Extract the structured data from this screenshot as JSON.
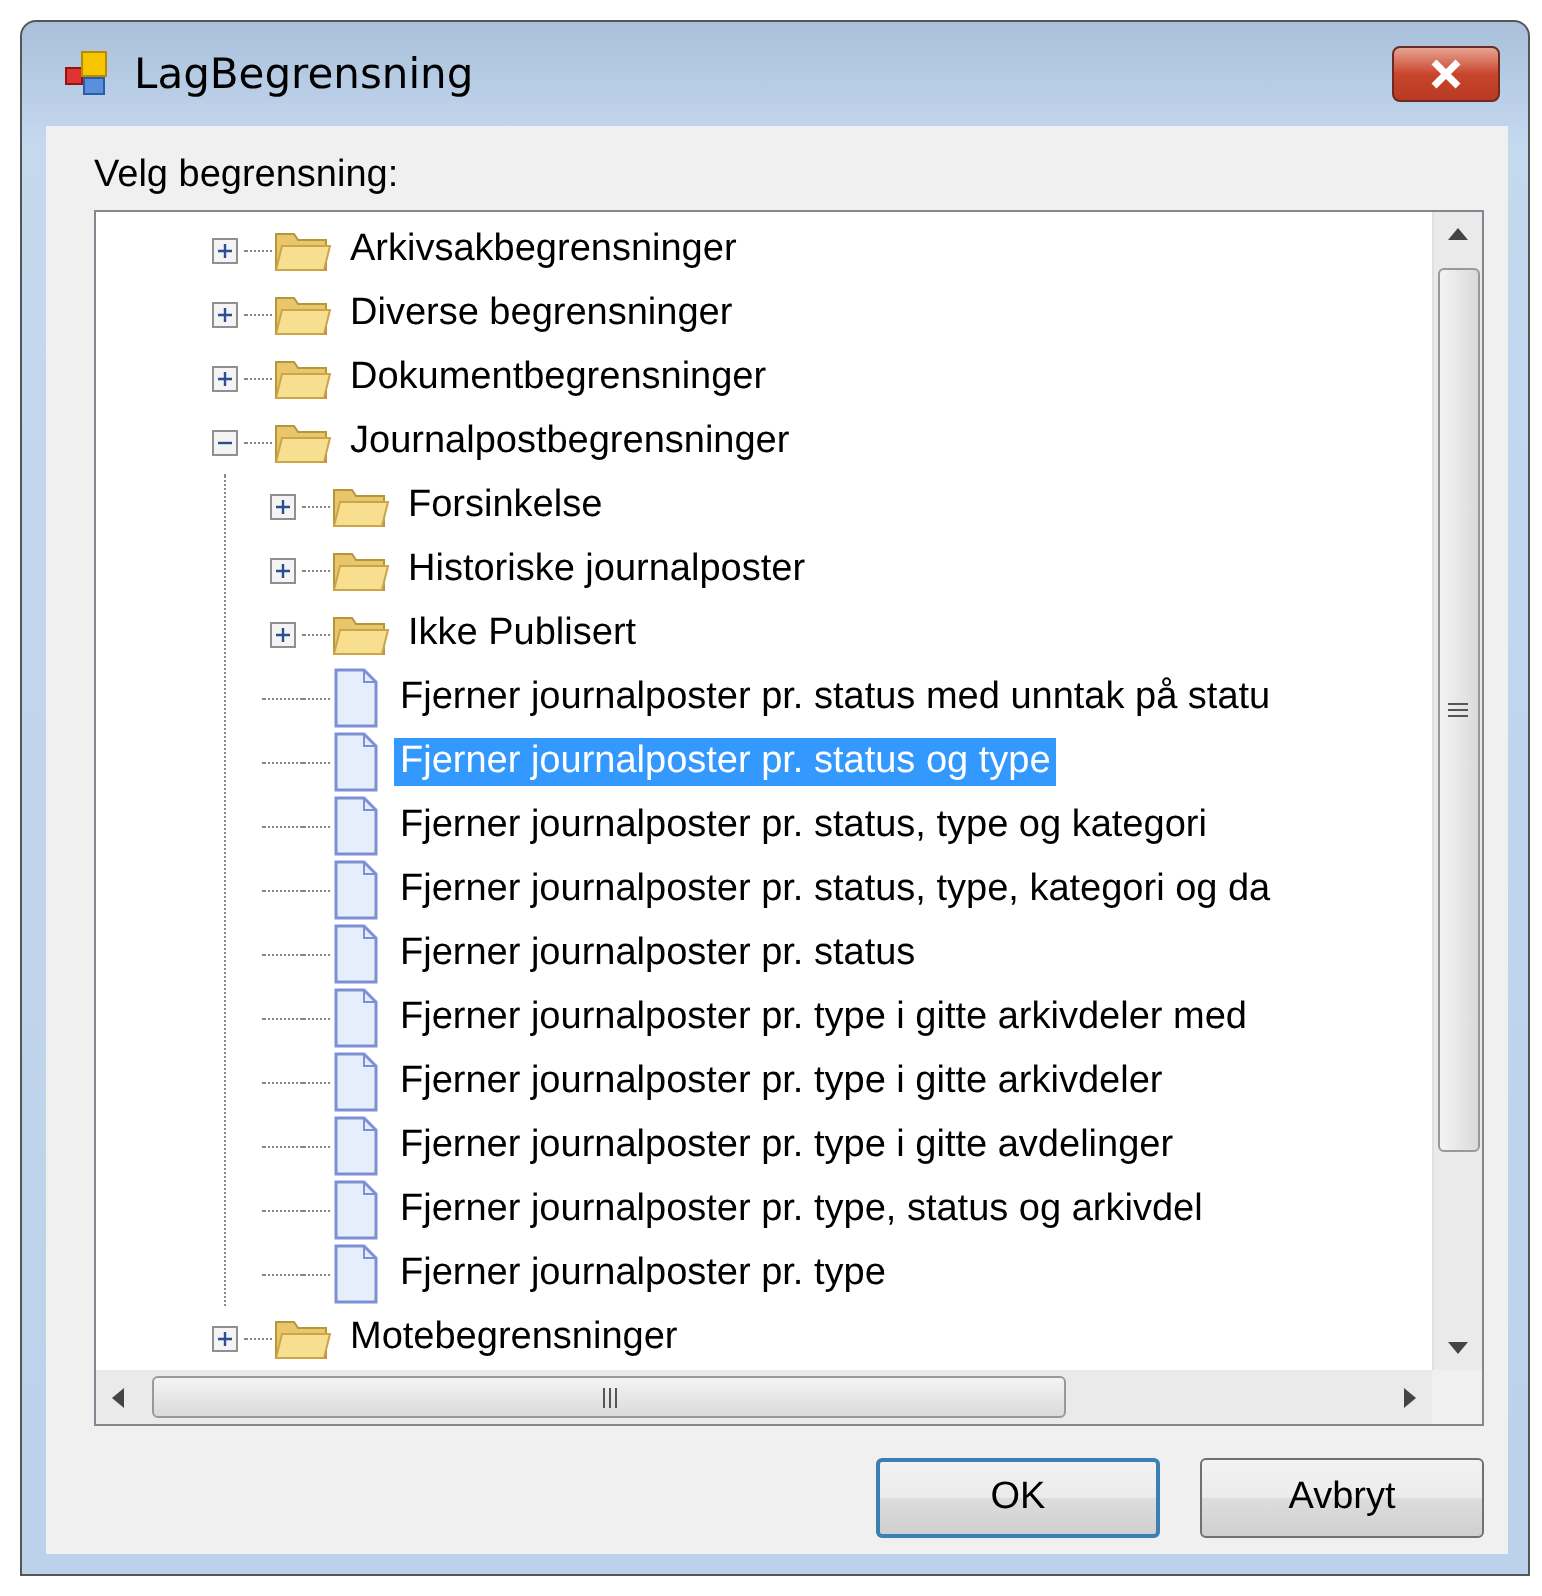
{
  "window": {
    "title": "LagBegrensning"
  },
  "label": "Velg begrensning:",
  "tree": [
    {
      "kind": "folder",
      "label": "Arkivsakbegrensninger",
      "expanded": false,
      "selected": false
    },
    {
      "kind": "folder",
      "label": "Diverse begrensninger",
      "expanded": false,
      "selected": false
    },
    {
      "kind": "folder",
      "label": "Dokumentbegrensninger",
      "expanded": false,
      "selected": false
    },
    {
      "kind": "folder",
      "label": "Journalpostbegrensninger",
      "expanded": true,
      "selected": false,
      "children": [
        {
          "kind": "folder",
          "label": "Forsinkelse",
          "expanded": false,
          "selected": false
        },
        {
          "kind": "folder",
          "label": "Historiske journalposter",
          "expanded": false,
          "selected": false
        },
        {
          "kind": "folder",
          "label": "Ikke Publisert",
          "expanded": false,
          "selected": false
        },
        {
          "kind": "document",
          "label": "Fjerner journalposter pr. status med unntak på statu",
          "selected": false
        },
        {
          "kind": "document",
          "label": "Fjerner journalposter pr. status og type",
          "selected": true
        },
        {
          "kind": "document",
          "label": "Fjerner journalposter pr. status, type og kategori",
          "selected": false
        },
        {
          "kind": "document",
          "label": "Fjerner journalposter pr. status, type, kategori og da",
          "selected": false
        },
        {
          "kind": "document",
          "label": "Fjerner journalposter pr. status",
          "selected": false
        },
        {
          "kind": "document",
          "label": "Fjerner journalposter pr. type i gitte arkivdeler med",
          "selected": false
        },
        {
          "kind": "document",
          "label": "Fjerner journalposter pr. type i gitte arkivdeler",
          "selected": false
        },
        {
          "kind": "document",
          "label": "Fjerner journalposter pr. type i gitte avdelinger",
          "selected": false
        },
        {
          "kind": "document",
          "label": "Fjerner journalposter pr. type, status og arkivdel",
          "selected": false
        },
        {
          "kind": "document",
          "label": "Fjerner journalposter pr. type",
          "selected": false
        }
      ]
    },
    {
      "kind": "folder",
      "label": "Motebegrensninger",
      "expanded": false,
      "selected": false
    }
  ],
  "buttons": [
    "OK",
    "Avbryt"
  ]
}
